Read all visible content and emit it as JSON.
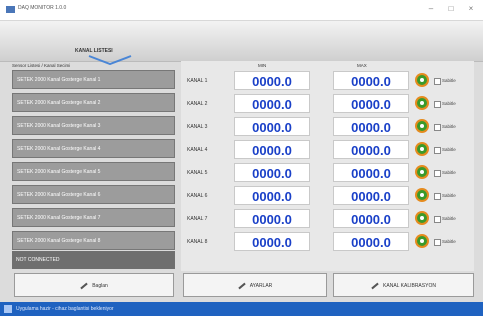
{
  "window": {
    "title": "DAQ MONITOR 1.0.0"
  },
  "header": {
    "logo_label": "KANAL LISTESI"
  },
  "list": {
    "header": "Sensor Listesi / Kanal Secimi"
  },
  "channels": [
    {
      "label": "SETEK 2000 Kanal Gosterge Kanal 1",
      "ch": "KANAL 1",
      "min": "0000.0",
      "max": "0000.0",
      "check": "Sabitle"
    },
    {
      "label": "SETEK 2000 Kanal Gosterge Kanal 2",
      "ch": "KANAL 2",
      "min": "0000.0",
      "max": "0000.0",
      "check": "Sabitle"
    },
    {
      "label": "SETEK 2000 Kanal Gosterge Kanal 3",
      "ch": "KANAL 3",
      "min": "0000.0",
      "max": "0000.0",
      "check": "Sabitle"
    },
    {
      "label": "SETEK 2000 Kanal Gosterge Kanal 4",
      "ch": "KANAL 4",
      "min": "0000.0",
      "max": "0000.0",
      "check": "Sabitle"
    },
    {
      "label": "SETEK 2000 Kanal Gosterge Kanal 5",
      "ch": "KANAL 5",
      "min": "0000.0",
      "max": "0000.0",
      "check": "Sabitle"
    },
    {
      "label": "SETEK 2000 Kanal Gosterge Kanal 6",
      "ch": "KANAL 6",
      "min": "0000.0",
      "max": "0000.0",
      "check": "Sabitle"
    },
    {
      "label": "SETEK 2000 Kanal Gosterge Kanal 7",
      "ch": "KANAL 7",
      "min": "0000.0",
      "max": "0000.0",
      "check": "Sabitle"
    },
    {
      "label": "SETEK 2000 Kanal Gosterge Kanal 8",
      "ch": "KANAL 8",
      "min": "0000.0",
      "max": "0000.0",
      "check": "Sabitle"
    }
  ],
  "columns": {
    "min": "MIN",
    "max": "MAX"
  },
  "status": {
    "text": "NOT CONNECTED"
  },
  "buttons": {
    "connect": "Baglan",
    "settings": "AYARLAR",
    "calibrate": "KANAL KALIBRASYON"
  },
  "taskbar": {
    "text": "Uygulama hazir - cihaz baglantisi bekleniyor"
  },
  "icons": {
    "app": "app-icon",
    "chevron": "chevron-down-icon",
    "knob": "dial-icon",
    "pen": "pencil-icon"
  },
  "colors": {
    "value_text": "#1a40c8",
    "row_bg": "#9c9c9c",
    "taskbar": "#1f62c0",
    "knob_green": "#3a9a2a",
    "knob_orange": "#e58b1e"
  }
}
